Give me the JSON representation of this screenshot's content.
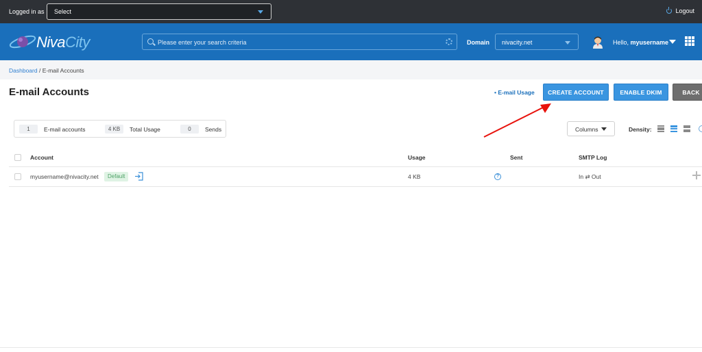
{
  "topbar": {
    "logged_in_label": "Logged in as",
    "login_select_value": "Select",
    "logout_label": "Logout"
  },
  "header": {
    "logo_niva": "Niva",
    "logo_city": "City",
    "search_placeholder": "Please enter your search criteria",
    "domain_label": "Domain",
    "domain_value": "nivacity.net",
    "greeting_prefix": "Hello,",
    "username": "myusername"
  },
  "breadcrumb": {
    "home": "Dashboard",
    "separator": " / ",
    "current": "E-mail Accounts"
  },
  "page": {
    "title": "E-mail Accounts",
    "usage_link": "• E-mail Usage",
    "buttons": {
      "create": "CREATE ACCOUNT",
      "dkim": "ENABLE DKIM",
      "back": "BACK"
    }
  },
  "stats": {
    "accounts_count": "1",
    "accounts_label": "E-mail accounts",
    "usage_value": "4 KB",
    "usage_label": "Total Usage",
    "sends_value": "0",
    "sends_label": "Sends"
  },
  "controls": {
    "columns_label": "Columns",
    "density_label": "Density:"
  },
  "table": {
    "headers": {
      "account": "Account",
      "usage": "Usage",
      "sent": "Sent",
      "smtp_log": "SMTP Log"
    },
    "rows": [
      {
        "account": "myusername@nivacity.net",
        "badge": "Default",
        "usage": "4 KB",
        "smtp_log": "In ⇄ Out"
      }
    ]
  },
  "colors": {
    "topbar": "#2e3136",
    "header": "#1a6fbb",
    "primary_button": "#3a95e0",
    "back_button": "#6e6e6e",
    "annotation_arrow": "#e8120c",
    "badge_bg": "#dff3e4"
  },
  "icons": [
    "power-icon",
    "search-icon",
    "gear-icon",
    "avatar",
    "apps-grid-icon",
    "login-icon",
    "help-icon",
    "plus-icon",
    "density-compact-icon",
    "density-normal-icon",
    "density-comfortable-icon"
  ]
}
